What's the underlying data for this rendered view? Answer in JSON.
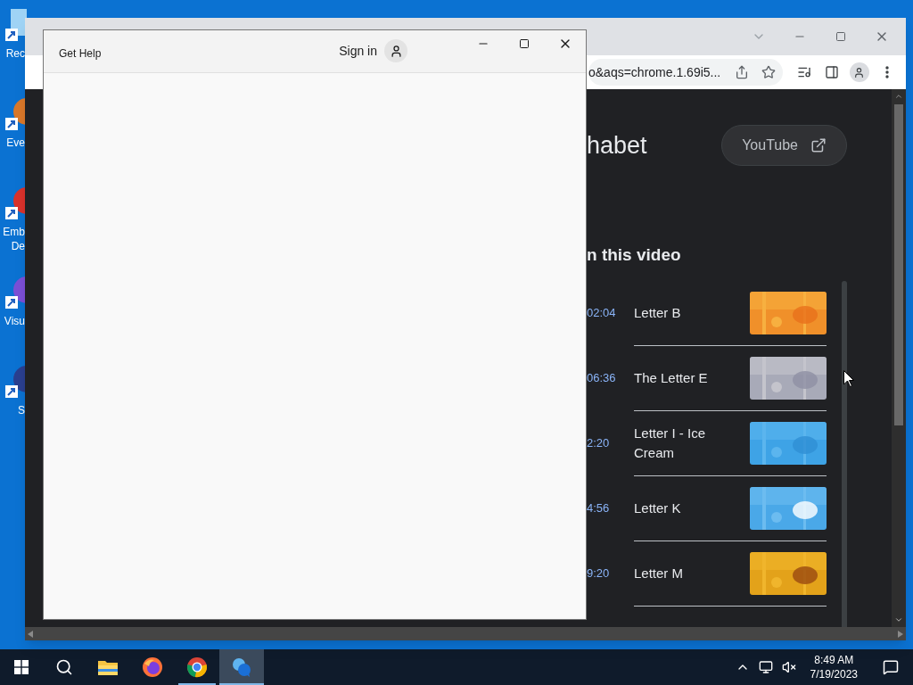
{
  "desktop_icons": [
    {
      "label_lines": [
        "Rec"
      ]
    },
    {
      "label_lines": [
        "Eve"
      ]
    },
    {
      "label_lines": [
        "Emb",
        "De"
      ]
    },
    {
      "label_lines": [
        "Visu"
      ]
    },
    {
      "label_lines": [
        "S"
      ]
    }
  ],
  "browser": {
    "address_text": "o&aqs=chrome.1.69i5...",
    "page_title": "habet",
    "youtube_button": "YouTube",
    "section_heading": "n this video",
    "chapters": [
      {
        "time": "02:04",
        "title": "Letter B"
      },
      {
        "time": "06:36",
        "title": "The Letter E"
      },
      {
        "time": "2:20",
        "title": "Letter I - Ice Cream"
      },
      {
        "time": "4:56",
        "title": "Letter K"
      },
      {
        "time": "9:20",
        "title": "Letter M"
      }
    ]
  },
  "help_window": {
    "title": "Get Help",
    "sign_in": "Sign in"
  },
  "taskbar": {
    "apps": [
      {
        "kind": "explorer",
        "running": false,
        "selected": false
      },
      {
        "kind": "firefox",
        "running": false,
        "selected": false
      },
      {
        "kind": "chrome",
        "running": true,
        "selected": false
      },
      {
        "kind": "help",
        "running": true,
        "selected": true
      }
    ],
    "time": "8:49 AM",
    "date": "7/19/2023"
  }
}
